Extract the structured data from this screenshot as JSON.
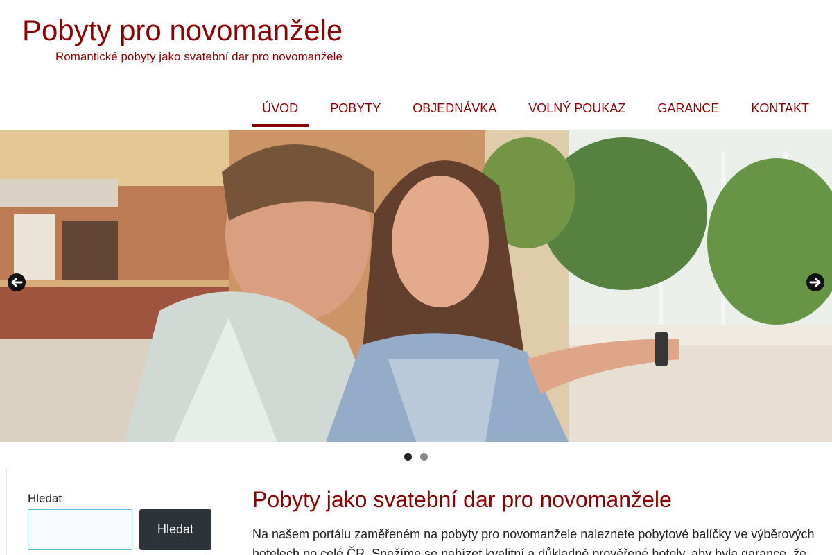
{
  "header": {
    "title": "Pobyty pro novomanžele",
    "tagline": "Romantické pobyty jako svatební dar pro novomanžele"
  },
  "nav": {
    "items": [
      {
        "label": "ÚVOD"
      },
      {
        "label": "POBYTY"
      },
      {
        "label": "OBJEDNÁVKA"
      },
      {
        "label": "VOLNÝ POUKAZ"
      },
      {
        "label": "GARANCE"
      },
      {
        "label": "KONTAKT"
      }
    ],
    "active_index": 0
  },
  "slider": {
    "slide_count": 2,
    "active_slide": 1,
    "prev_icon": "arrow-left-icon",
    "next_icon": "arrow-right-icon"
  },
  "sidebar": {
    "search_label": "Hledat",
    "search_value": "",
    "search_button": "Hledat"
  },
  "main": {
    "heading": "Pobyty jako svatební dar pro novomanžele",
    "intro": "Na našem portálu zaměřeném na pobyty pro novomanžele naleznete pobytové balíčky ve výběrových hotelech po celé ČR. Snažíme se nabízet kvalitní a důkladně prověřené hotely, aby byla garance, že"
  },
  "colors": {
    "brand": "#8b0000",
    "button": "#2d3439",
    "input_border": "#5bc0de"
  }
}
